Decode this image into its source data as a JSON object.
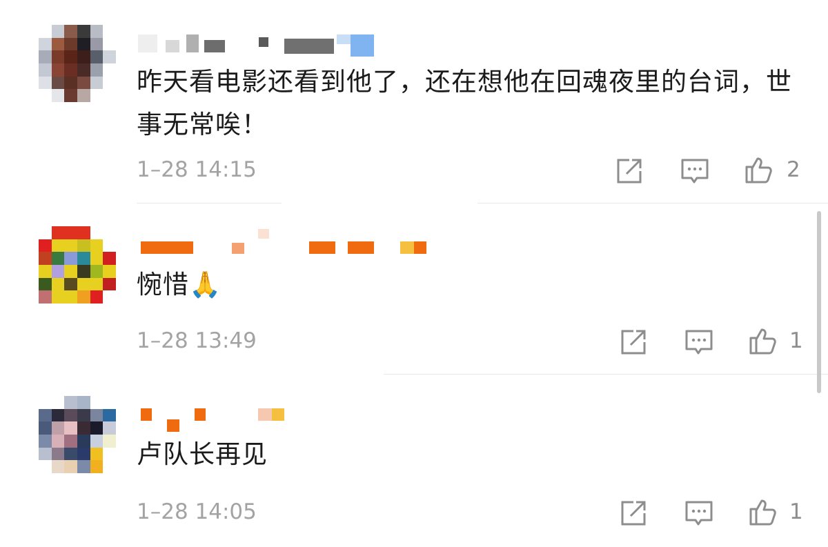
{
  "comments": [
    {
      "text": "昨天看电影还看到他了，还在想他在回魂夜里的台词，世事无常唉！",
      "time": "1–28 14:15",
      "like_count": "2",
      "username_colors": [
        "#d8d8d8",
        "#6d6d6d",
        "#5a5a5a",
        "#7fb4f0"
      ]
    },
    {
      "text": "惋惜🙏",
      "time": "1–28 13:49",
      "like_count": "1",
      "username_colors": [
        "#f06a10",
        "#f4a070",
        "#f06a10",
        "#f5c040"
      ]
    },
    {
      "text": "卢队长再见",
      "time": "1–28 14:05",
      "like_count": "1",
      "username_colors": [
        "#f06a10",
        "#f06a10",
        "#f7c8b0",
        "#f5c040"
      ]
    }
  ],
  "icons": {
    "share": "share-icon",
    "reply": "comment-icon",
    "like": "thumbs-up-icon"
  }
}
